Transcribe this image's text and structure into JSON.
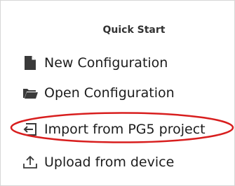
{
  "panel": {
    "title": "Quick Start",
    "items": [
      {
        "label": "New Configuration",
        "icon": "file-icon"
      },
      {
        "label": "Open Configuration",
        "icon": "folder-open-icon"
      },
      {
        "label": "Import from PG5 project",
        "icon": "import-icon"
      },
      {
        "label": "Upload from device",
        "icon": "upload-icon"
      }
    ]
  },
  "colors": {
    "highlight": "#d81e1e",
    "text": "#1c1c1c",
    "icon": "#3a3a3a"
  }
}
